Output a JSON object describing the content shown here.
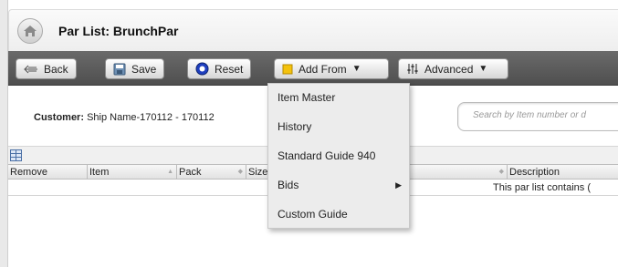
{
  "header": {
    "title": "Par List: BrunchPar"
  },
  "toolbar": {
    "back_label": "Back",
    "save_label": "Save",
    "reset_label": "Reset",
    "add_from_label": "Add From",
    "advanced_label": "Advanced"
  },
  "filter": {
    "customer_label": "Customer:",
    "customer_value": "Ship Name-170112 - 170112",
    "search_placeholder": "Search by Item number or d"
  },
  "grid": {
    "columns": [
      "Remove",
      "Item",
      "Pack",
      "Size",
      "Description"
    ],
    "empty_message": "This par list contains ("
  },
  "dropdown": {
    "items": [
      "Item Master",
      "History",
      "Standard Guide 940",
      "Bids",
      "Custom Guide"
    ]
  },
  "colors": {
    "toolbar": "#5c5c5c",
    "add_from_icon": "#f4c20d",
    "reset_icon": "#1f3fbf"
  },
  "icons": {
    "home": "home-icon",
    "back": "back-arrow-icon",
    "save": "save-icon",
    "reset": "reset-icon",
    "add_from": "add-from-icon",
    "advanced": "advanced-settings-icon",
    "grid_config": "grid-config-icon",
    "submenu": "submenu-arrow-icon"
  }
}
